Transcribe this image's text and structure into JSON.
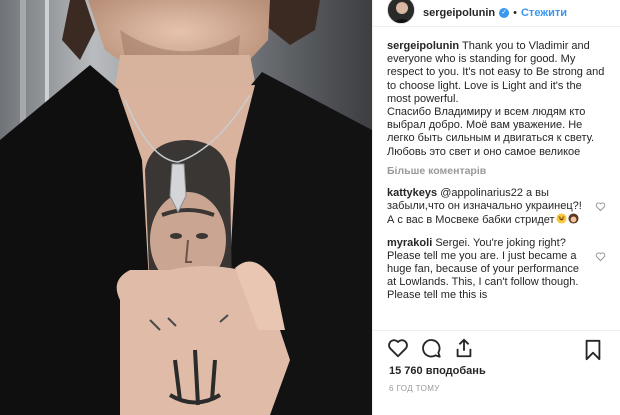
{
  "post": {
    "author": "sergeipolunin",
    "follow_label": "Стежити",
    "caption": "Thank you to Vladimir and everyone who is standing for good. My respect to you. It's not easy to Be strong and to choose light. Love is Light and it's the most powerful.\nСпасибо Владимиру и всем людям кто выбрал добро. Моё вам уважение. Не легко быть сильным и двигаться к свету. Любовь это свет и оно самое великое",
    "more_comments_label": "Більше коментарів",
    "comments": [
      {
        "user": "kattykeys",
        "text": "@appolinarius22 а вы забыли,что он изначально украинец?!А с вас в Мосвеке бабки стридет"
      },
      {
        "user": "myrakoli",
        "text": "Sergei. You're joking right? Please tell me you are. I just became a huge fan, because of your performance at Lowlands. This, I can't follow though. Please tell me this is"
      }
    ],
    "likes_label": "15 760 вподобань",
    "time_label": "6 ГОД ТОМУ"
  },
  "icons": {
    "like": "heart-icon",
    "comment": "comment-icon",
    "share": "share-icon",
    "save": "bookmark-icon",
    "verified": "verified-badge-icon"
  },
  "colors": {
    "link": "#3897f0",
    "muted": "#999999",
    "text": "#262626"
  }
}
